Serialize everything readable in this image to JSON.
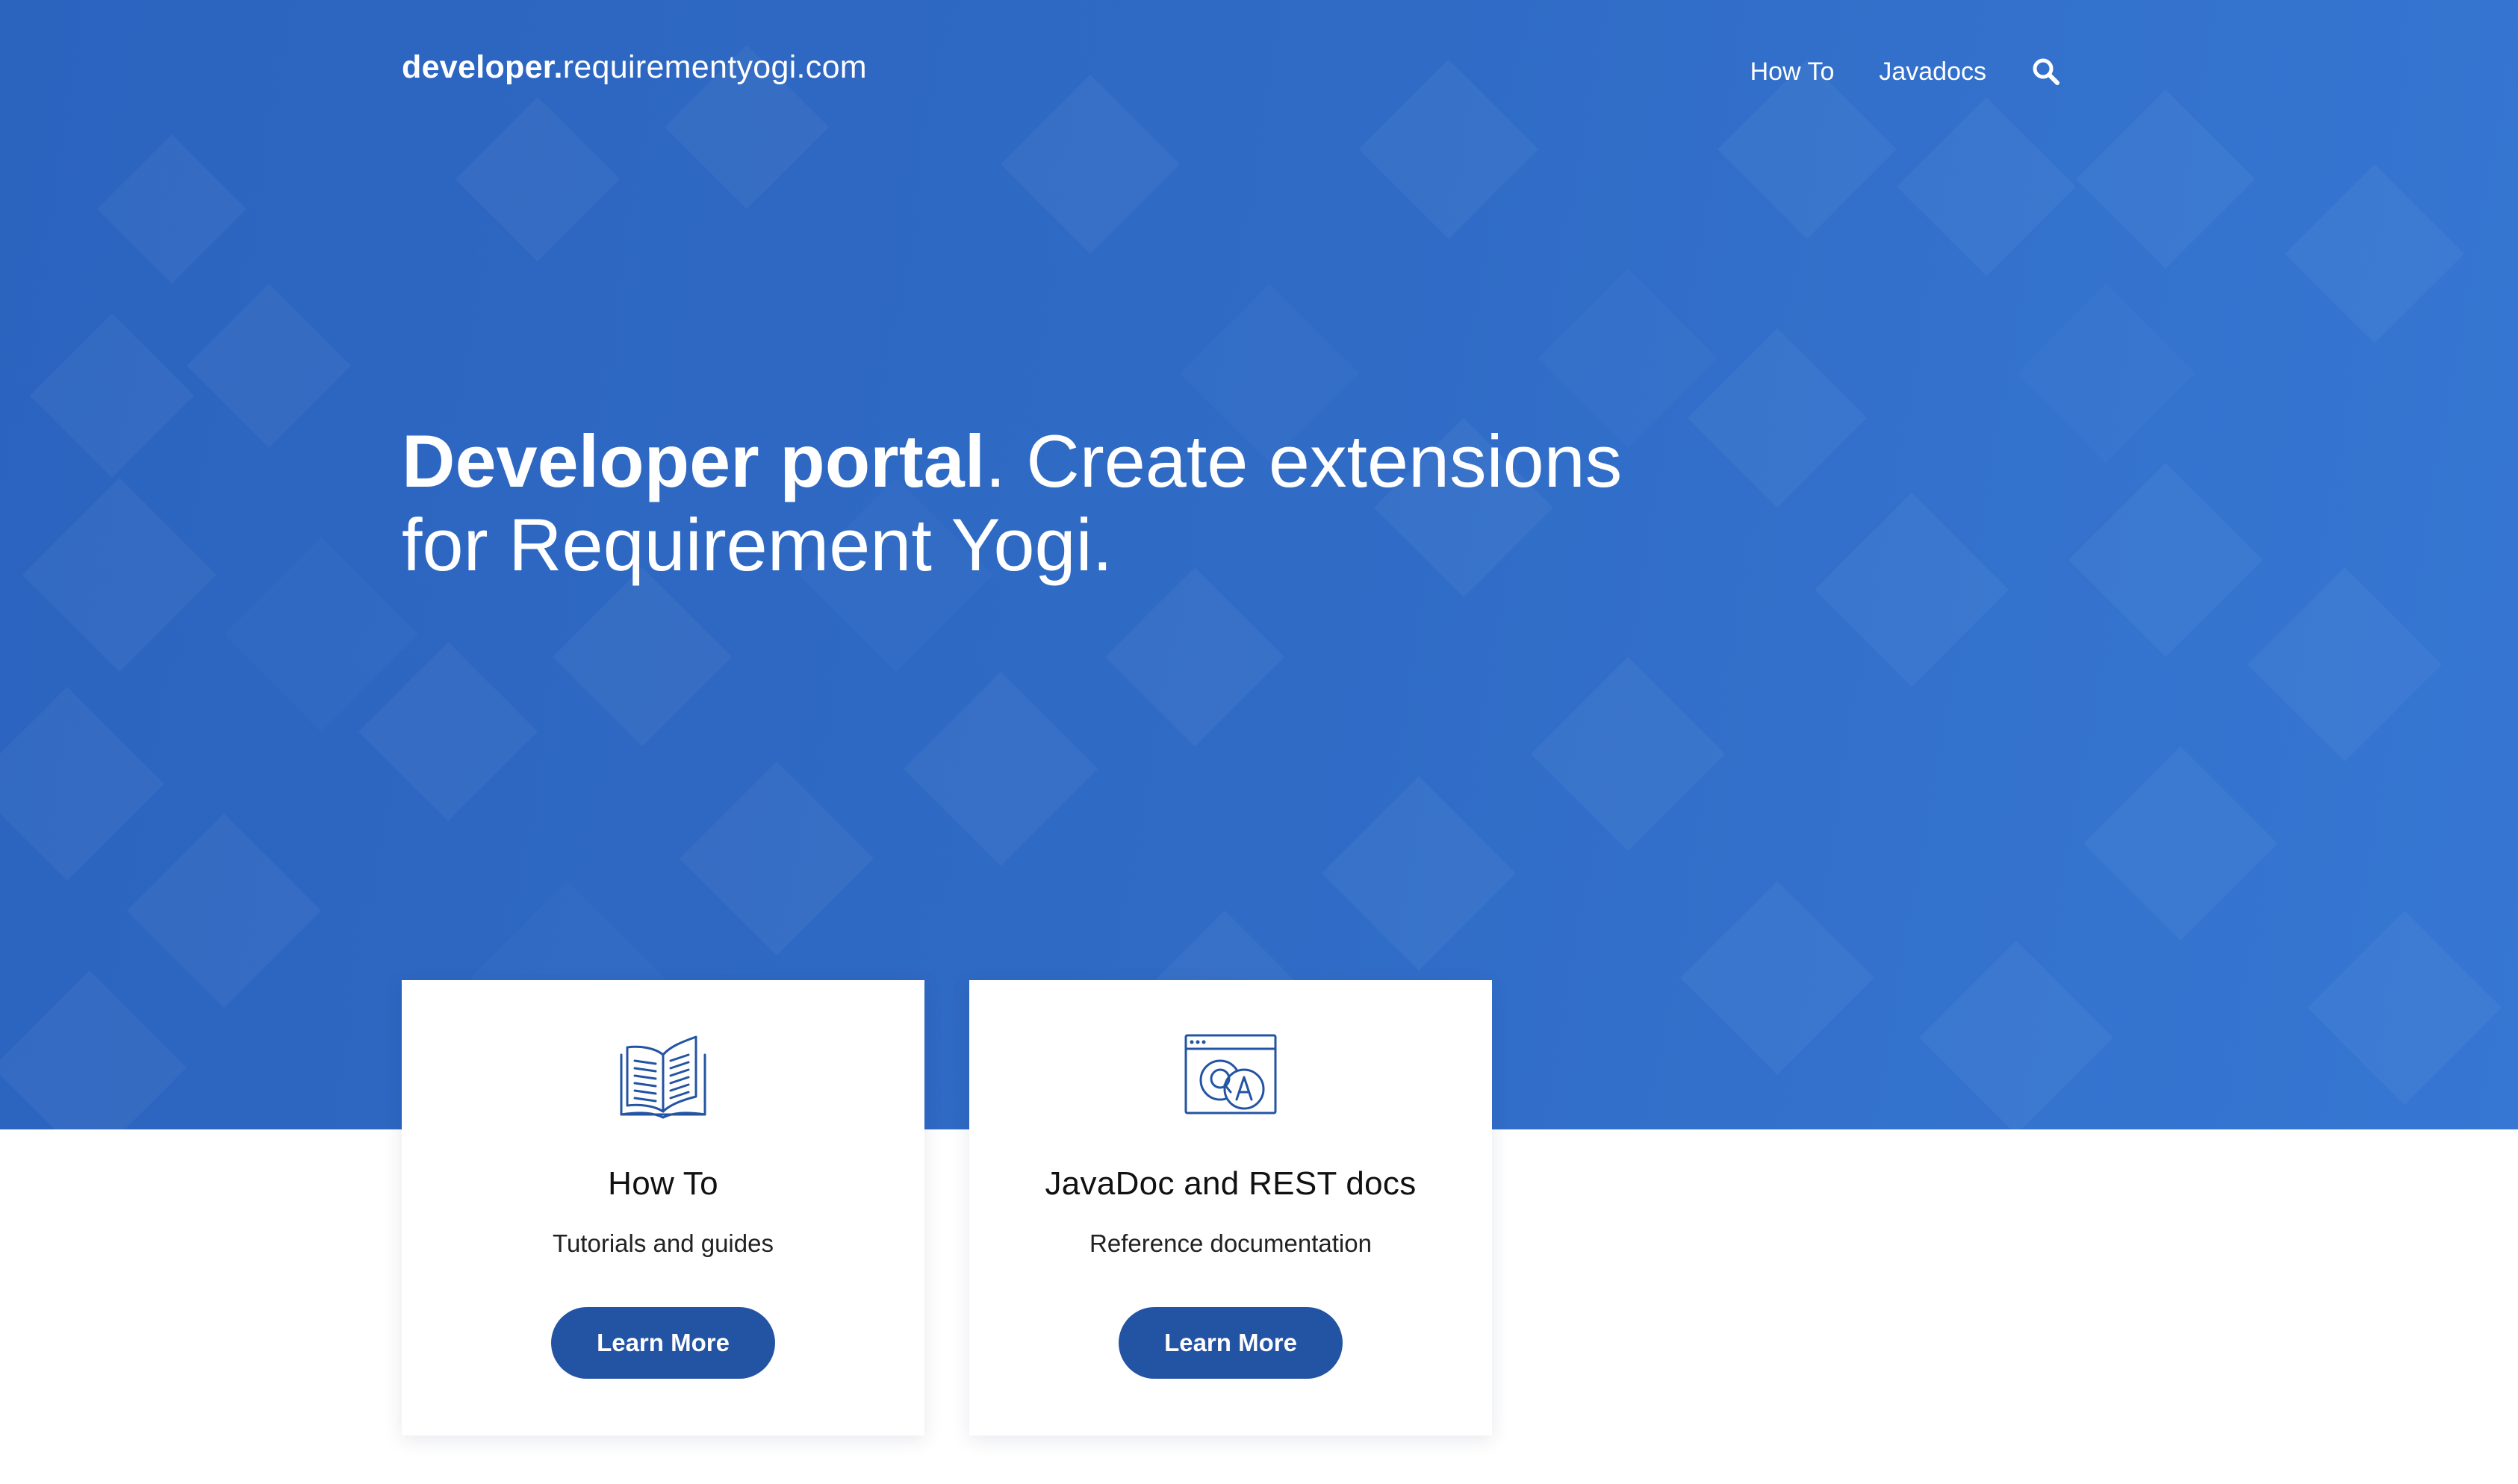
{
  "site": {
    "brand_bold": "developer.",
    "brand_rest": "requirementyogi.com"
  },
  "nav": {
    "items": [
      {
        "label": "How To"
      },
      {
        "label": "Javadocs"
      }
    ],
    "search_icon": "search-icon"
  },
  "hero": {
    "headline_bold": "Developer portal",
    "headline_rest": ". Create extensions for Requirement Yogi."
  },
  "cards": [
    {
      "icon": "open-book-icon",
      "title": "How To",
      "description": "Tutorials and guides",
      "button_label": "Learn More"
    },
    {
      "icon": "qa-window-icon",
      "title": "JavaDoc and REST docs",
      "description": "Reference documentation",
      "button_label": "Learn More"
    }
  ],
  "colors": {
    "hero_background": "#2f6ac4",
    "button": "#2354a3",
    "icon_stroke": "#2354a3"
  }
}
